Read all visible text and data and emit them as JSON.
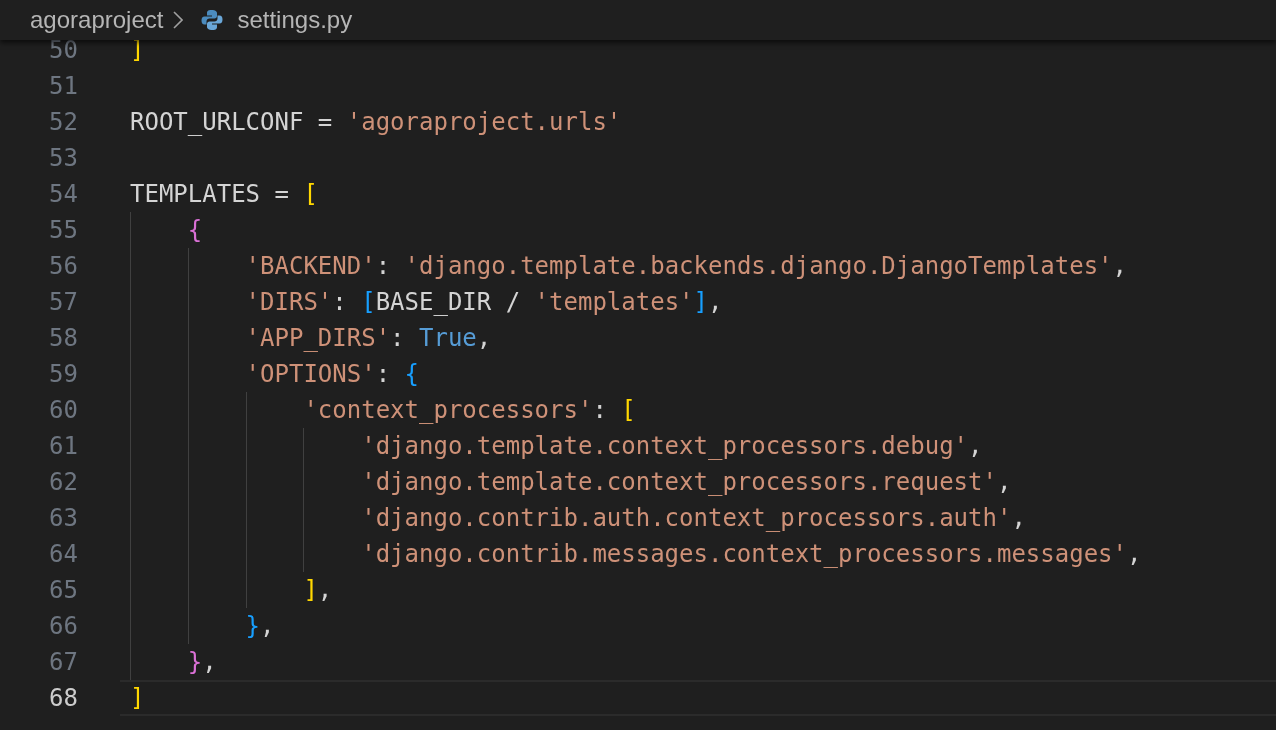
{
  "breadcrumb": {
    "folder": "agoraproject",
    "file": "settings.py"
  },
  "lines": [
    {
      "number": "50",
      "current": false,
      "tokens": [
        {
          "kind": "bracket1",
          "text": "]"
        }
      ]
    },
    {
      "number": "51",
      "current": false
    },
    {
      "number": "52",
      "current": false,
      "tokens": [
        {
          "kind": "plain",
          "text": "ROOT_URLCONF = "
        },
        {
          "kind": "string",
          "text": "'agoraproject.urls'"
        }
      ]
    },
    {
      "number": "53",
      "current": false
    },
    {
      "number": "54",
      "current": false,
      "tokens": [
        {
          "kind": "plain",
          "text": "TEMPLATES = "
        },
        {
          "kind": "bracket1",
          "text": "["
        }
      ]
    },
    {
      "number": "55",
      "current": false,
      "tokens": [
        {
          "kind": "bracket2",
          "text": "    {"
        }
      ]
    },
    {
      "number": "56",
      "current": false,
      "tokens": [
        {
          "kind": "string",
          "text": "        'BACKEND'"
        },
        {
          "kind": "plain",
          "text": ": "
        },
        {
          "kind": "string",
          "text": "'django.template.backends.django.DjangoTemplates'"
        },
        {
          "kind": "plain",
          "text": ","
        }
      ]
    },
    {
      "number": "57",
      "current": false,
      "tokens": [
        {
          "kind": "string",
          "text": "        'DIRS'"
        },
        {
          "kind": "plain",
          "text": ": "
        },
        {
          "kind": "bracket3",
          "text": "["
        },
        {
          "kind": "plain",
          "text": "BASE_DIR / "
        },
        {
          "kind": "string",
          "text": "'templates'"
        },
        {
          "kind": "bracket3",
          "text": "]"
        },
        {
          "kind": "plain",
          "text": ","
        }
      ]
    },
    {
      "number": "58",
      "current": false,
      "tokens": [
        {
          "kind": "string",
          "text": "        'APP_DIRS'"
        },
        {
          "kind": "plain",
          "text": ": "
        },
        {
          "kind": "constant",
          "text": "True"
        },
        {
          "kind": "plain",
          "text": ","
        }
      ]
    },
    {
      "number": "59",
      "current": false,
      "tokens": [
        {
          "kind": "string",
          "text": "        'OPTIONS'"
        },
        {
          "kind": "plain",
          "text": ": "
        },
        {
          "kind": "bracket3",
          "text": "{"
        }
      ]
    },
    {
      "number": "60",
      "current": false,
      "tokens": [
        {
          "kind": "string",
          "text": "            'context_processors'"
        },
        {
          "kind": "plain",
          "text": ": "
        },
        {
          "kind": "bracket1",
          "text": "["
        }
      ]
    },
    {
      "number": "61",
      "current": false,
      "tokens": [
        {
          "kind": "string",
          "text": "                'django.template.context_processors.debug'"
        },
        {
          "kind": "plain",
          "text": ","
        }
      ]
    },
    {
      "number": "62",
      "current": false,
      "tokens": [
        {
          "kind": "string",
          "text": "                'django.template.context_processors.request'"
        },
        {
          "kind": "plain",
          "text": ","
        }
      ]
    },
    {
      "number": "63",
      "current": false,
      "tokens": [
        {
          "kind": "string",
          "text": "                'django.contrib.auth.context_processors.auth'"
        },
        {
          "kind": "plain",
          "text": ","
        }
      ]
    },
    {
      "number": "64",
      "current": false,
      "tokens": [
        {
          "kind": "string",
          "text": "                'django.contrib.messages.context_processors.messages'"
        },
        {
          "kind": "plain",
          "text": ","
        }
      ]
    },
    {
      "number": "65",
      "current": false,
      "tokens": [
        {
          "kind": "bracket1",
          "text": "            ]"
        },
        {
          "kind": "plain",
          "text": ","
        }
      ]
    },
    {
      "number": "66",
      "current": false,
      "tokens": [
        {
          "kind": "bracket3",
          "text": "        }"
        },
        {
          "kind": "plain",
          "text": ","
        }
      ]
    },
    {
      "number": "67",
      "current": false,
      "tokens": [
        {
          "kind": "bracket2",
          "text": "    }"
        },
        {
          "kind": "plain",
          "text": ","
        }
      ]
    },
    {
      "number": "68",
      "current": true,
      "tokens": [
        {
          "kind": "bracket1",
          "text": "]"
        }
      ]
    }
  ]
}
